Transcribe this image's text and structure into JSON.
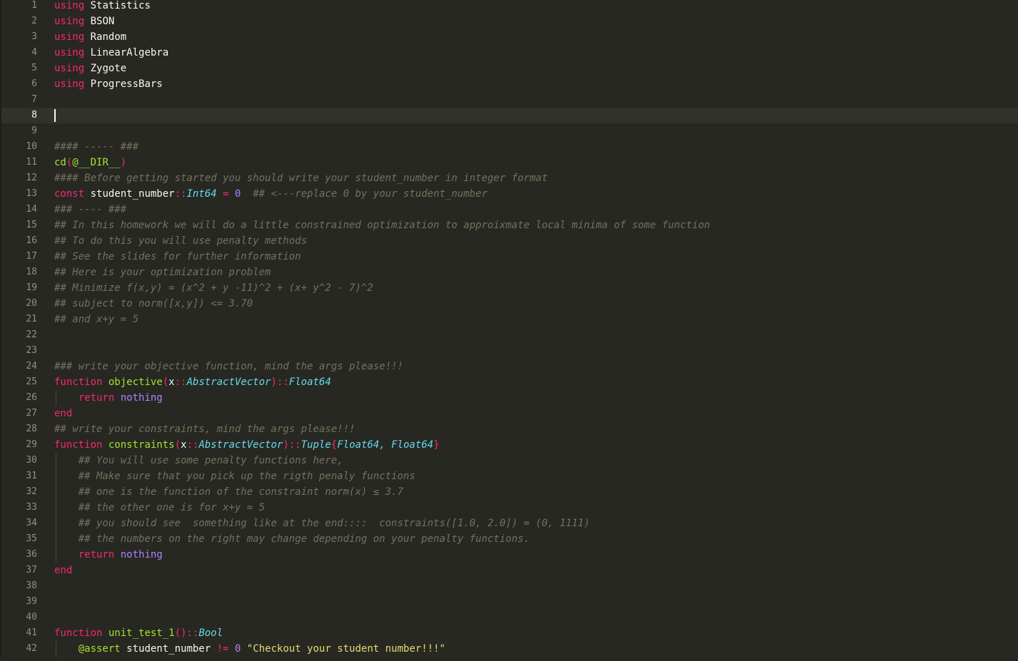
{
  "editor": {
    "current_line": 8,
    "lines": [
      {
        "n": "1",
        "tokens": [
          {
            "t": "using",
            "c": "kw"
          },
          {
            "t": " Statistics",
            "c": "pl"
          }
        ]
      },
      {
        "n": "2",
        "tokens": [
          {
            "t": "using",
            "c": "kw"
          },
          {
            "t": " BSON",
            "c": "pl"
          }
        ]
      },
      {
        "n": "3",
        "tokens": [
          {
            "t": "using",
            "c": "kw"
          },
          {
            "t": " Random",
            "c": "pl"
          }
        ]
      },
      {
        "n": "4",
        "tokens": [
          {
            "t": "using",
            "c": "kw"
          },
          {
            "t": " LinearAlgebra",
            "c": "pl"
          }
        ]
      },
      {
        "n": "5",
        "tokens": [
          {
            "t": "using",
            "c": "kw"
          },
          {
            "t": " Zygote",
            "c": "pl"
          }
        ]
      },
      {
        "n": "6",
        "tokens": [
          {
            "t": "using",
            "c": "kw"
          },
          {
            "t": " ProgressBars",
            "c": "pl"
          }
        ]
      },
      {
        "n": "7",
        "tokens": []
      },
      {
        "n": "8",
        "tokens": []
      },
      {
        "n": "9",
        "tokens": []
      },
      {
        "n": "10",
        "tokens": [
          {
            "t": "#### ----- ###",
            "c": "cm"
          }
        ]
      },
      {
        "n": "11",
        "tokens": [
          {
            "t": "cd",
            "c": "fn"
          },
          {
            "t": "(",
            "c": "op"
          },
          {
            "t": "@__DIR__",
            "c": "fn"
          },
          {
            "t": ")",
            "c": "op"
          }
        ]
      },
      {
        "n": "12",
        "tokens": [
          {
            "t": "#### Before getting started you should write your student_number in integer format",
            "c": "cm"
          }
        ]
      },
      {
        "n": "13",
        "tokens": [
          {
            "t": "const",
            "c": "kw"
          },
          {
            "t": " student_number",
            "c": "pl"
          },
          {
            "t": "::",
            "c": "op"
          },
          {
            "t": "Int64",
            "c": "ty"
          },
          {
            "t": " = ",
            "c": "op"
          },
          {
            "t": "0",
            "c": "cst"
          },
          {
            "t": "  ",
            "c": "pl"
          },
          {
            "t": "## <---replace 0 by your student_number",
            "c": "cm"
          }
        ]
      },
      {
        "n": "14",
        "tokens": [
          {
            "t": "### ---- ###",
            "c": "cm"
          }
        ]
      },
      {
        "n": "15",
        "tokens": [
          {
            "t": "## In this homework we will do a little constrained optimization to approixmate local minima of some function",
            "c": "cm"
          }
        ]
      },
      {
        "n": "16",
        "tokens": [
          {
            "t": "## To do this you will use penalty methods",
            "c": "cm"
          }
        ]
      },
      {
        "n": "17",
        "tokens": [
          {
            "t": "## See the slides for further information",
            "c": "cm"
          }
        ]
      },
      {
        "n": "18",
        "tokens": [
          {
            "t": "## Here is your optimization problem",
            "c": "cm"
          }
        ]
      },
      {
        "n": "19",
        "tokens": [
          {
            "t": "## Minimize f(x,y) = (x^2 + y -11)^2 + (x+ y^2 - 7)^2",
            "c": "cm"
          }
        ]
      },
      {
        "n": "20",
        "tokens": [
          {
            "t": "## subject to norm([x,y]) <= 3.70",
            "c": "cm"
          }
        ]
      },
      {
        "n": "21",
        "tokens": [
          {
            "t": "## and x+y = 5",
            "c": "cm"
          }
        ]
      },
      {
        "n": "22",
        "tokens": []
      },
      {
        "n": "23",
        "tokens": []
      },
      {
        "n": "24",
        "tokens": [
          {
            "t": "### write your objective function, mind the args please!!!",
            "c": "cm"
          }
        ]
      },
      {
        "n": "25",
        "tokens": [
          {
            "t": "function",
            "c": "kw"
          },
          {
            "t": " objective",
            "c": "fn"
          },
          {
            "t": "(",
            "c": "op"
          },
          {
            "t": "x",
            "c": "pl"
          },
          {
            "t": "::",
            "c": "op"
          },
          {
            "t": "AbstractVector",
            "c": "ty"
          },
          {
            "t": ")",
            "c": "op"
          },
          {
            "t": "::",
            "c": "op"
          },
          {
            "t": "Float64",
            "c": "ty"
          }
        ]
      },
      {
        "n": "26",
        "guide": true,
        "tokens": [
          {
            "t": "    return",
            "c": "kw"
          },
          {
            "t": " nothing",
            "c": "cst"
          }
        ]
      },
      {
        "n": "27",
        "tokens": [
          {
            "t": "end",
            "c": "kw"
          }
        ]
      },
      {
        "n": "28",
        "tokens": [
          {
            "t": "## write your constraints, mind the args please!!!",
            "c": "cm"
          }
        ]
      },
      {
        "n": "29",
        "tokens": [
          {
            "t": "function",
            "c": "kw"
          },
          {
            "t": " constraints",
            "c": "fn"
          },
          {
            "t": "(",
            "c": "op"
          },
          {
            "t": "x",
            "c": "pl"
          },
          {
            "t": "::",
            "c": "op"
          },
          {
            "t": "AbstractVector",
            "c": "ty"
          },
          {
            "t": ")",
            "c": "op"
          },
          {
            "t": "::",
            "c": "op"
          },
          {
            "t": "Tuple",
            "c": "ty"
          },
          {
            "t": "{",
            "c": "op"
          },
          {
            "t": "Float64, Float64",
            "c": "ty"
          },
          {
            "t": "}",
            "c": "op"
          }
        ]
      },
      {
        "n": "30",
        "guide": true,
        "tokens": [
          {
            "t": "    ",
            "c": "pl"
          },
          {
            "t": "## You will use some penalty functions here,",
            "c": "cm"
          }
        ]
      },
      {
        "n": "31",
        "guide": true,
        "tokens": [
          {
            "t": "    ",
            "c": "pl"
          },
          {
            "t": "## Make sure that you pick up the rigth penaly functions",
            "c": "cm"
          }
        ]
      },
      {
        "n": "32",
        "guide": true,
        "tokens": [
          {
            "t": "    ",
            "c": "pl"
          },
          {
            "t": "## one is the function of the constraint norm(x) ≤ 3.7",
            "c": "cm"
          }
        ]
      },
      {
        "n": "33",
        "guide": true,
        "tokens": [
          {
            "t": "    ",
            "c": "pl"
          },
          {
            "t": "## the other one is for x+y = 5",
            "c": "cm"
          }
        ]
      },
      {
        "n": "34",
        "guide": true,
        "tokens": [
          {
            "t": "    ",
            "c": "pl"
          },
          {
            "t": "## you should see  something like at the end::::  constraints([1.0, 2.0]) = (0, 1111)",
            "c": "cm"
          }
        ]
      },
      {
        "n": "35",
        "guide": true,
        "tokens": [
          {
            "t": "    ",
            "c": "pl"
          },
          {
            "t": "## the numbers on the right may change depending on your penalty functions.",
            "c": "cm"
          }
        ]
      },
      {
        "n": "36",
        "guide": true,
        "tokens": [
          {
            "t": "    return",
            "c": "kw"
          },
          {
            "t": " nothing",
            "c": "cst"
          }
        ]
      },
      {
        "n": "37",
        "tokens": [
          {
            "t": "end",
            "c": "kw"
          }
        ]
      },
      {
        "n": "38",
        "tokens": []
      },
      {
        "n": "39",
        "tokens": []
      },
      {
        "n": "40",
        "tokens": []
      },
      {
        "n": "41",
        "tokens": [
          {
            "t": "function",
            "c": "kw"
          },
          {
            "t": " unit_test_1",
            "c": "fn"
          },
          {
            "t": "()",
            "c": "op"
          },
          {
            "t": "::",
            "c": "op"
          },
          {
            "t": "Bool",
            "c": "ty"
          }
        ]
      },
      {
        "n": "42",
        "guide": true,
        "tokens": [
          {
            "t": "    ",
            "c": "pl"
          },
          {
            "t": "@assert",
            "c": "fn"
          },
          {
            "t": " student_number ",
            "c": "pl"
          },
          {
            "t": "!=",
            "c": "op"
          },
          {
            "t": " ",
            "c": "pl"
          },
          {
            "t": "0",
            "c": "cst"
          },
          {
            "t": " ",
            "c": "pl"
          },
          {
            "t": "\"Checkout your student number!!!\"",
            "c": "str"
          }
        ]
      }
    ]
  }
}
